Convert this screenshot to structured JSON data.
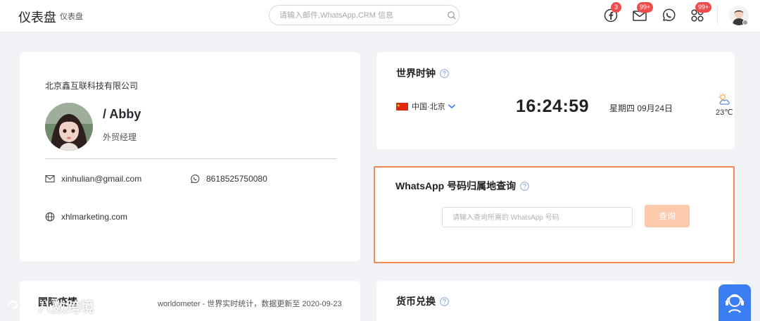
{
  "header": {
    "title": "仪表盘",
    "breadcrumb": "仪表盘",
    "search_placeholder": "请输入邮件,WhatsApp,CRM 信息",
    "badges": {
      "facebook": "3",
      "mail": "99+",
      "apps": "99+"
    },
    "icons": [
      "facebook-icon",
      "mail-icon",
      "whatsapp-icon",
      "apps-icon",
      "search-icon"
    ]
  },
  "profile": {
    "company": "北京鑫互联科技有限公司",
    "name": "/ Abby",
    "role": "外贸经理",
    "email": "xinhulian@gmail.com",
    "phone": "8618525750080",
    "website": "xhlmarketing.com"
  },
  "world_clock": {
    "title": "世界时钟",
    "city": "中国·北京",
    "time": "16:24:59",
    "date": "星期四 09月24日",
    "temperature": "23℃"
  },
  "whatsapp_lookup": {
    "title": "WhatsApp 号码归属地查询",
    "input_placeholder": "请输入查询所需的 WhatsApp 号码",
    "button": "查询"
  },
  "covid": {
    "title": "国际疫情",
    "source": "worldometer - 世界实时统计，数据更新至 2020-09-23"
  },
  "currency": {
    "title": "货币兑换"
  },
  "watermark": {
    "text": "八数跨境"
  },
  "colors": {
    "accent_orange": "#ee8a52",
    "button_disabled": "#fcc9ad",
    "badge_red": "#ef4d4d",
    "support_blue": "#3b7df3",
    "background": "#f1f2f6"
  }
}
